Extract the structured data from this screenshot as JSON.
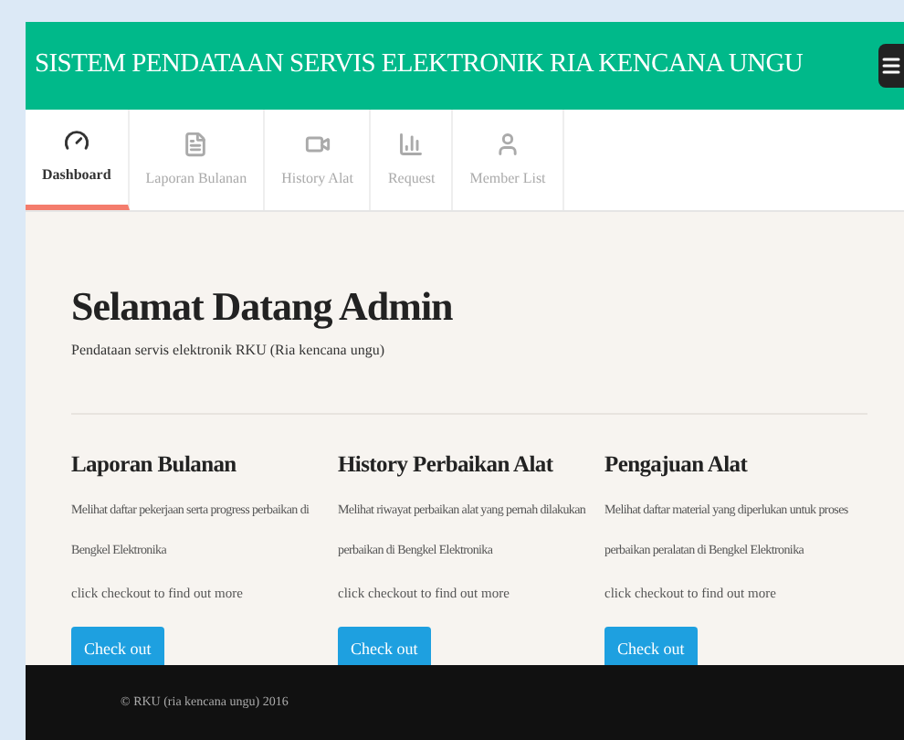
{
  "header": {
    "title": "SISTEM PENDATAAN SERVIS ELEKTRONIK RIA KENCANA UNGU"
  },
  "tabs": [
    {
      "label": "Dashboard",
      "selected": true
    },
    {
      "label": "Laporan Bulanan",
      "selected": false
    },
    {
      "label": "History Alat",
      "selected": false
    },
    {
      "label": "Request",
      "selected": false
    },
    {
      "label": "Member List",
      "selected": false
    }
  ],
  "welcome": {
    "heading": "Selamat Datang Admin",
    "subtitle": "Pendataan servis elektronik RKU (Ria kencana ungu)"
  },
  "cards": [
    {
      "title": "Laporan Bulanan",
      "description": "Melihat daftar pekerjaan serta progress perbaikan di Bengkel Elektronika",
      "note": "click checkout to find out more",
      "button": "Check out"
    },
    {
      "title": "History Perbaikan Alat",
      "description": "Melihat riwayat perbaikan alat yang pernah dilakukan perbaikan di Bengkel Elektronika",
      "note": "click checkout to find out more",
      "button": "Check out"
    },
    {
      "title": "Pengajuan Alat",
      "description": "Melihat daftar material yang diperlukan untuk proses perbaikan peralatan di Bengkel Elektronika",
      "note": "click checkout to find out more",
      "button": "Check out"
    }
  ],
  "footer": {
    "text": "© RKU (ria kencana ungu) 2016"
  }
}
